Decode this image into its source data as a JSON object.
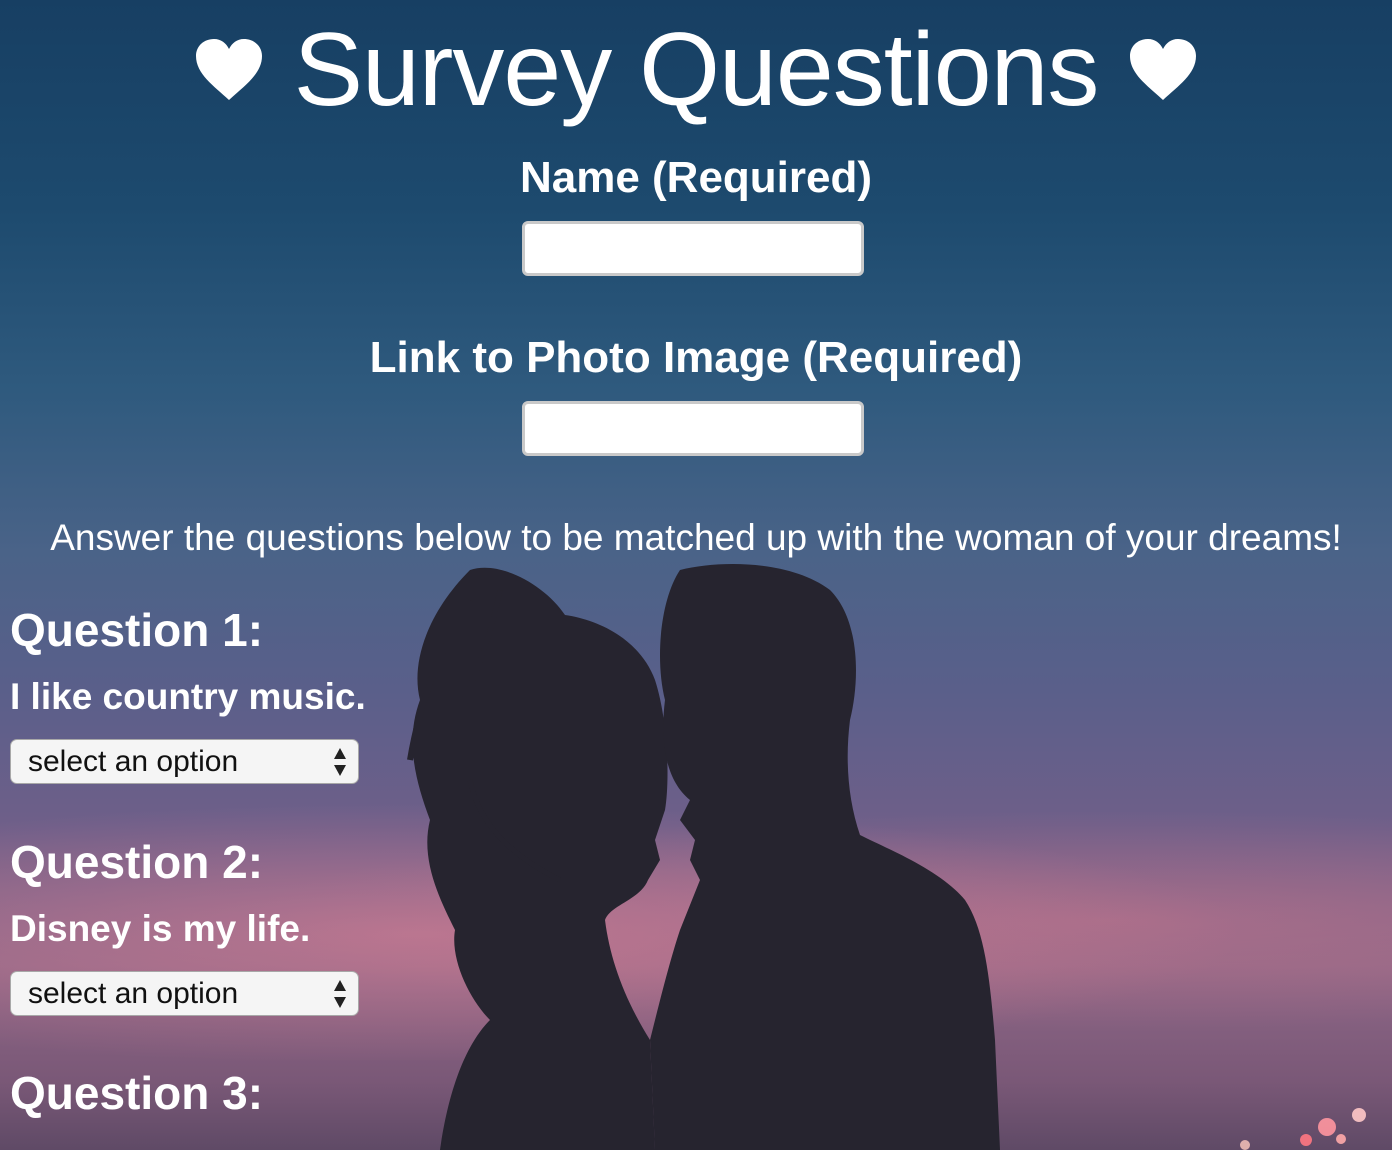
{
  "page": {
    "title": "Survey Questions",
    "title_icon": "heart-icon"
  },
  "fields": {
    "name_label": "Name (Required)",
    "name_value": "",
    "photo_label": "Link to Photo Image (Required)",
    "photo_value": ""
  },
  "intro": "Answer the questions below to be matched up with the woman of your dreams!",
  "questions": [
    {
      "heading": "Question 1:",
      "text": "I like country music.",
      "selected": "select an option"
    },
    {
      "heading": "Question 2:",
      "text": "Disney is my life.",
      "selected": "select an option"
    },
    {
      "heading": "Question 3:"
    }
  ],
  "colors": {
    "text": "#ffffff",
    "sky_top": "#173f63",
    "sky_bottom": "#8e6787",
    "silhouette": "#26242f"
  }
}
